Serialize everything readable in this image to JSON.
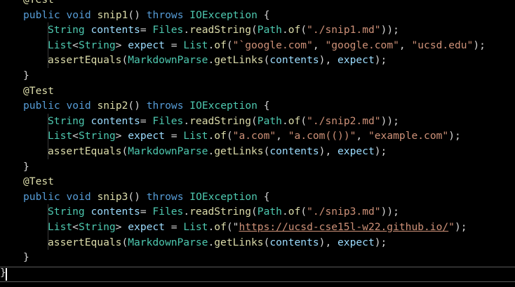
{
  "editor": {
    "colors": {
      "background": "#000000",
      "annotation": "#dcdcaa",
      "keyword": "#569cd6",
      "function": "#dcdcaa",
      "type": "#4ec9b0",
      "variable": "#9cdcfe",
      "string": "#ce9178",
      "punctuation": "#d4d4d4"
    },
    "lines": [
      {
        "indent": 1,
        "tokens": [
          {
            "t": "@Test",
            "k": "ann"
          }
        ]
      },
      {
        "indent": 1,
        "tokens": [
          {
            "t": "public",
            "k": "kw"
          },
          {
            "t": " "
          },
          {
            "t": "void",
            "k": "kw"
          },
          {
            "t": " "
          },
          {
            "t": "snip1",
            "k": "fn"
          },
          {
            "t": "() "
          },
          {
            "t": "throws",
            "k": "kw"
          },
          {
            "t": " "
          },
          {
            "t": "IOException",
            "k": "type"
          },
          {
            "t": " {"
          }
        ]
      },
      {
        "indent": 2,
        "tokens": [
          {
            "t": "String",
            "k": "type"
          },
          {
            "t": " "
          },
          {
            "t": "contents",
            "k": "var"
          },
          {
            "t": "= "
          },
          {
            "t": "Files",
            "k": "type"
          },
          {
            "t": "."
          },
          {
            "t": "readString",
            "k": "fn"
          },
          {
            "t": "("
          },
          {
            "t": "Path",
            "k": "type"
          },
          {
            "t": "."
          },
          {
            "t": "of",
            "k": "fn"
          },
          {
            "t": "("
          },
          {
            "t": "\"./snip1.md\"",
            "k": "str"
          },
          {
            "t": "));"
          }
        ]
      },
      {
        "indent": 2,
        "tokens": [
          {
            "t": "List",
            "k": "type"
          },
          {
            "t": "<"
          },
          {
            "t": "String",
            "k": "type"
          },
          {
            "t": "> "
          },
          {
            "t": "expect",
            "k": "var"
          },
          {
            "t": " = "
          },
          {
            "t": "List",
            "k": "type"
          },
          {
            "t": "."
          },
          {
            "t": "of",
            "k": "fn"
          },
          {
            "t": "("
          },
          {
            "t": "\"`google.com\"",
            "k": "str"
          },
          {
            "t": ", "
          },
          {
            "t": "\"google.com\"",
            "k": "str"
          },
          {
            "t": ", "
          },
          {
            "t": "\"ucsd.edu\"",
            "k": "str"
          },
          {
            "t": ");"
          }
        ]
      },
      {
        "indent": 2,
        "tokens": [
          {
            "t": "assertEquals",
            "k": "fn"
          },
          {
            "t": "("
          },
          {
            "t": "MarkdownParse",
            "k": "type"
          },
          {
            "t": "."
          },
          {
            "t": "getLinks",
            "k": "fn"
          },
          {
            "t": "("
          },
          {
            "t": "contents",
            "k": "var"
          },
          {
            "t": "), "
          },
          {
            "t": "expect",
            "k": "var"
          },
          {
            "t": ");"
          }
        ]
      },
      {
        "indent": 1,
        "tokens": [
          {
            "t": "}"
          }
        ]
      },
      {
        "indent": 1,
        "tokens": [
          {
            "t": "@Test",
            "k": "ann"
          }
        ]
      },
      {
        "indent": 1,
        "tokens": [
          {
            "t": "public",
            "k": "kw"
          },
          {
            "t": " "
          },
          {
            "t": "void",
            "k": "kw"
          },
          {
            "t": " "
          },
          {
            "t": "snip2",
            "k": "fn"
          },
          {
            "t": "() "
          },
          {
            "t": "throws",
            "k": "kw"
          },
          {
            "t": " "
          },
          {
            "t": "IOException",
            "k": "type"
          },
          {
            "t": " {"
          }
        ]
      },
      {
        "indent": 2,
        "tokens": [
          {
            "t": "String",
            "k": "type"
          },
          {
            "t": " "
          },
          {
            "t": "contents",
            "k": "var"
          },
          {
            "t": "= "
          },
          {
            "t": "Files",
            "k": "type"
          },
          {
            "t": "."
          },
          {
            "t": "readString",
            "k": "fn"
          },
          {
            "t": "("
          },
          {
            "t": "Path",
            "k": "type"
          },
          {
            "t": "."
          },
          {
            "t": "of",
            "k": "fn"
          },
          {
            "t": "("
          },
          {
            "t": "\"./snip2.md\"",
            "k": "str"
          },
          {
            "t": "));"
          }
        ]
      },
      {
        "indent": 2,
        "tokens": [
          {
            "t": "List",
            "k": "type"
          },
          {
            "t": "<"
          },
          {
            "t": "String",
            "k": "type"
          },
          {
            "t": "> "
          },
          {
            "t": "expect",
            "k": "var"
          },
          {
            "t": " = "
          },
          {
            "t": "List",
            "k": "type"
          },
          {
            "t": "."
          },
          {
            "t": "of",
            "k": "fn"
          },
          {
            "t": "("
          },
          {
            "t": "\"a.com\"",
            "k": "str"
          },
          {
            "t": ", "
          },
          {
            "t": "\"a.com(())\"",
            "k": "str"
          },
          {
            "t": ", "
          },
          {
            "t": "\"example.com\"",
            "k": "str"
          },
          {
            "t": ");"
          }
        ]
      },
      {
        "indent": 2,
        "tokens": [
          {
            "t": "assertEquals",
            "k": "fn"
          },
          {
            "t": "("
          },
          {
            "t": "MarkdownParse",
            "k": "type"
          },
          {
            "t": "."
          },
          {
            "t": "getLinks",
            "k": "fn"
          },
          {
            "t": "("
          },
          {
            "t": "contents",
            "k": "var"
          },
          {
            "t": "), "
          },
          {
            "t": "expect",
            "k": "var"
          },
          {
            "t": ");"
          }
        ]
      },
      {
        "indent": 1,
        "tokens": [
          {
            "t": "}"
          }
        ]
      },
      {
        "indent": 1,
        "tokens": [
          {
            "t": "@Test",
            "k": "ann"
          }
        ]
      },
      {
        "indent": 1,
        "tokens": [
          {
            "t": "public",
            "k": "kw"
          },
          {
            "t": " "
          },
          {
            "t": "void",
            "k": "kw"
          },
          {
            "t": " "
          },
          {
            "t": "snip3",
            "k": "fn"
          },
          {
            "t": "() "
          },
          {
            "t": "throws",
            "k": "kw"
          },
          {
            "t": " "
          },
          {
            "t": "IOException",
            "k": "type"
          },
          {
            "t": " {"
          }
        ]
      },
      {
        "indent": 2,
        "tokens": [
          {
            "t": "String",
            "k": "type"
          },
          {
            "t": " "
          },
          {
            "t": "contents",
            "k": "var"
          },
          {
            "t": "= "
          },
          {
            "t": "Files",
            "k": "type"
          },
          {
            "t": "."
          },
          {
            "t": "readString",
            "k": "fn"
          },
          {
            "t": "("
          },
          {
            "t": "Path",
            "k": "type"
          },
          {
            "t": "."
          },
          {
            "t": "of",
            "k": "fn"
          },
          {
            "t": "("
          },
          {
            "t": "\"./snip3.md\"",
            "k": "str"
          },
          {
            "t": "));"
          }
        ]
      },
      {
        "indent": 2,
        "tokens": [
          {
            "t": "List",
            "k": "type"
          },
          {
            "t": "<"
          },
          {
            "t": "String",
            "k": "type"
          },
          {
            "t": "> "
          },
          {
            "t": "expect",
            "k": "var"
          },
          {
            "t": " = "
          },
          {
            "t": "List",
            "k": "type"
          },
          {
            "t": "."
          },
          {
            "t": "of",
            "k": "fn"
          },
          {
            "t": "(\""
          },
          {
            "t": "https://ucsd-cse15l-w22.github.io/",
            "k": "url"
          },
          {
            "t": "\"",
            "k": "str"
          },
          {
            "t": ");"
          }
        ]
      },
      {
        "indent": 2,
        "tokens": [
          {
            "t": "assertEquals",
            "k": "fn"
          },
          {
            "t": "("
          },
          {
            "t": "MarkdownParse",
            "k": "type"
          },
          {
            "t": "."
          },
          {
            "t": "getLinks",
            "k": "fn"
          },
          {
            "t": "("
          },
          {
            "t": "contents",
            "k": "var"
          },
          {
            "t": "), "
          },
          {
            "t": "expect",
            "k": "var"
          },
          {
            "t": ");"
          }
        ]
      },
      {
        "indent": 1,
        "tokens": [
          {
            "t": "}"
          }
        ]
      },
      {
        "indent": 0,
        "tokens": [
          {
            "t": "}"
          }
        ]
      }
    ]
  }
}
